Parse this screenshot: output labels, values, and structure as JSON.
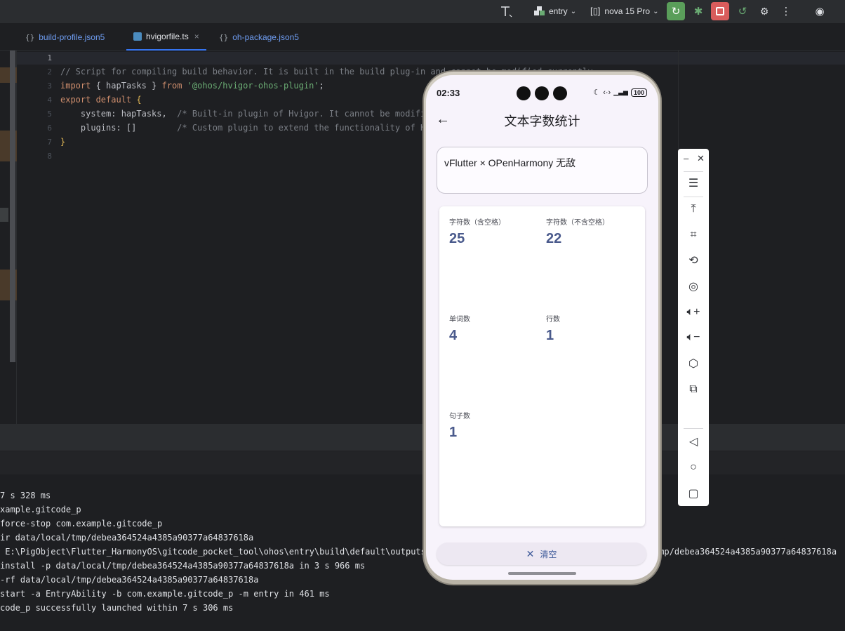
{
  "toolbar": {
    "entry_label": "entry",
    "device_label": "nova 15 Pro"
  },
  "tabs": [
    {
      "icon": "{}",
      "label": "build-profile.json5"
    },
    {
      "icon": "ts",
      "label": "hvigorfile.ts"
    },
    {
      "icon": "{}",
      "label": "oh-package.json5"
    }
  ],
  "editor": {
    "line_numbers": [
      "1",
      "2",
      "3",
      "4",
      "5",
      "6",
      "7",
      "8"
    ],
    "line2": "// Script for compiling build behavior. It is built in the build plug-in and cannot be modified currently.",
    "line3_kw": "import",
    "line3_mid": "{ hapTasks }",
    "line3_from": "from",
    "line3_str": "'@ohos/hvigor-ohos-plugin'",
    "line3_end": ";",
    "line4_kw": "export default",
    "line4_brace": "{",
    "line5_code": "    system: hapTasks,  ",
    "line5_cmt": "/* Built-in plugin of Hvigor. It cannot be modified. */",
    "line6_code": "    plugins: []        ",
    "line6_cmt": "/* Custom plugin to extend the functionality of Hvigor. */",
    "line7_brace": "}"
  },
  "console": [
    "7 s 328 ms",
    "xample.gitcode_p",
    "force-stop com.example.gitcode_p",
    "ir data/local/tmp/debea364524a4385a90377a64837618a",
    " E:\\PigObject\\Flutter_HarmonyOS\\gitcode_pocket_tool\\ohos\\entry\\build\\default\\outputs\\default\\entry-default-signed.hap data/local/tmp/debea364524a4385a90377a64837618a",
    "install -p data/local/tmp/debea364524a4385a90377a64837618a in 3 s 966 ms",
    "-rf data/local/tmp/debea364524a4385a90377a64837618a",
    "start -a EntryAbility -b com.example.gitcode_p -m entry in 461 ms",
    "code_p successfully launched within 7 s 306 ms"
  ],
  "phone": {
    "time": "02:33",
    "battery": "100",
    "title": "文本字数统计",
    "input_value": "vFlutter × OPenHarmony 无敌",
    "stats": [
      {
        "label": "字符数（含空格）",
        "value": "25"
      },
      {
        "label": "字符数（不含空格）",
        "value": "22"
      },
      {
        "label": "单词数",
        "value": "4"
      },
      {
        "label": "行数",
        "value": "1"
      },
      {
        "label": "句子数",
        "value": "1"
      }
    ],
    "clear_label": "清空"
  }
}
